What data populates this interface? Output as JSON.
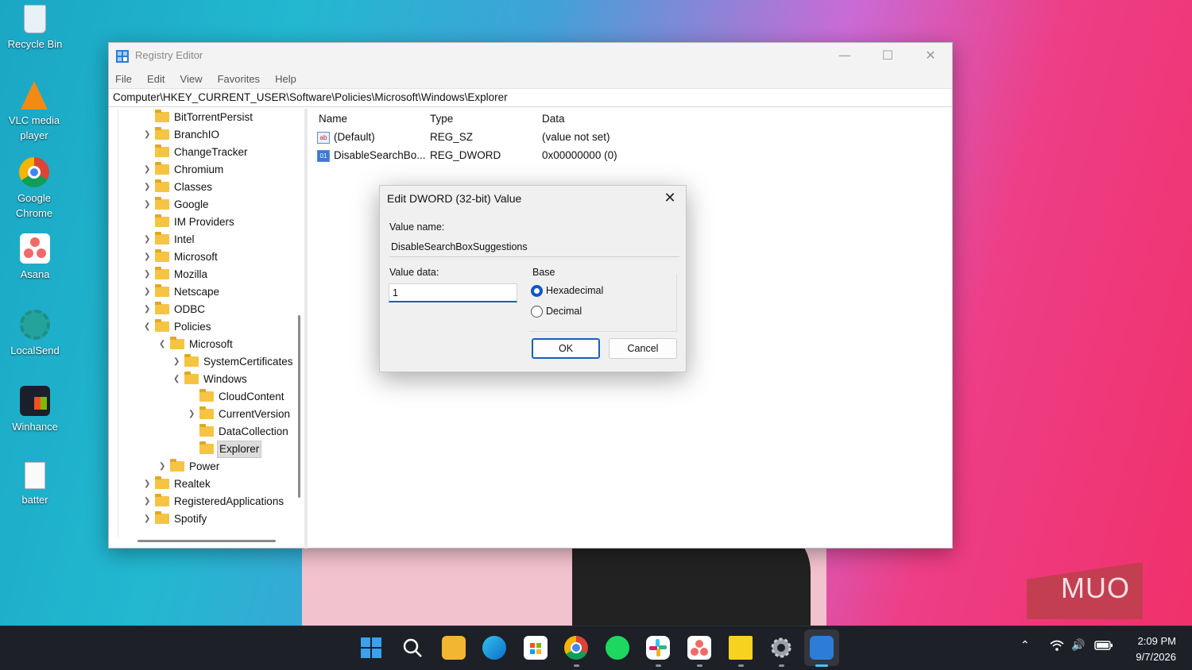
{
  "desktop": {
    "icons": [
      {
        "label": "Recycle Bin"
      },
      {
        "label": "VLC media player"
      },
      {
        "label": "Google Chrome"
      },
      {
        "label": "Asana"
      },
      {
        "label": "LocalSend"
      },
      {
        "label": "Winhance"
      },
      {
        "label": "batter"
      }
    ],
    "watermark": "MUO"
  },
  "window": {
    "title": "Registry Editor",
    "menu": [
      "File",
      "Edit",
      "View",
      "Favorites",
      "Help"
    ],
    "address": "Computer\\HKEY_CURRENT_USER\\Software\\Policies\\Microsoft\\Windows\\Explorer",
    "tree": [
      {
        "label": "BitTorrentPersist"
      },
      {
        "label": "BranchIO"
      },
      {
        "label": "ChangeTracker"
      },
      {
        "label": "Chromium"
      },
      {
        "label": "Classes"
      },
      {
        "label": "Google"
      },
      {
        "label": "IM Providers"
      },
      {
        "label": "Intel"
      },
      {
        "label": "Microsoft"
      },
      {
        "label": "Mozilla"
      },
      {
        "label": "Netscape"
      },
      {
        "label": "ODBC"
      },
      {
        "label": "Policies"
      },
      {
        "label": "Microsoft"
      },
      {
        "label": "SystemCertificates"
      },
      {
        "label": "Windows"
      },
      {
        "label": "CloudContent"
      },
      {
        "label": "CurrentVersion"
      },
      {
        "label": "DataCollection"
      },
      {
        "label": "Explorer"
      },
      {
        "label": "Power"
      },
      {
        "label": "Realtek"
      },
      {
        "label": "RegisteredApplications"
      },
      {
        "label": "Spotify"
      }
    ],
    "columns": {
      "name": "Name",
      "type": "Type",
      "data": "Data"
    },
    "values": [
      {
        "name": "(Default)",
        "type": "REG_SZ",
        "data": "(value not set)"
      },
      {
        "name": "DisableSearchBo...",
        "type": "REG_DWORD",
        "data": "0x00000000 (0)"
      }
    ]
  },
  "dialog": {
    "title": "Edit DWORD (32-bit) Value",
    "value_name_label": "Value name:",
    "value_name": "DisableSearchBoxSuggestions",
    "value_data_label": "Value data:",
    "value_data": "1",
    "base_label": "Base",
    "hex_label": "Hexadecimal",
    "dec_label": "Decimal",
    "selected_base": "Hexadecimal",
    "ok_label": "OK",
    "cancel_label": "Cancel"
  },
  "taskbar": {
    "time": "2:09 PM",
    "date": "9/7/2026"
  }
}
